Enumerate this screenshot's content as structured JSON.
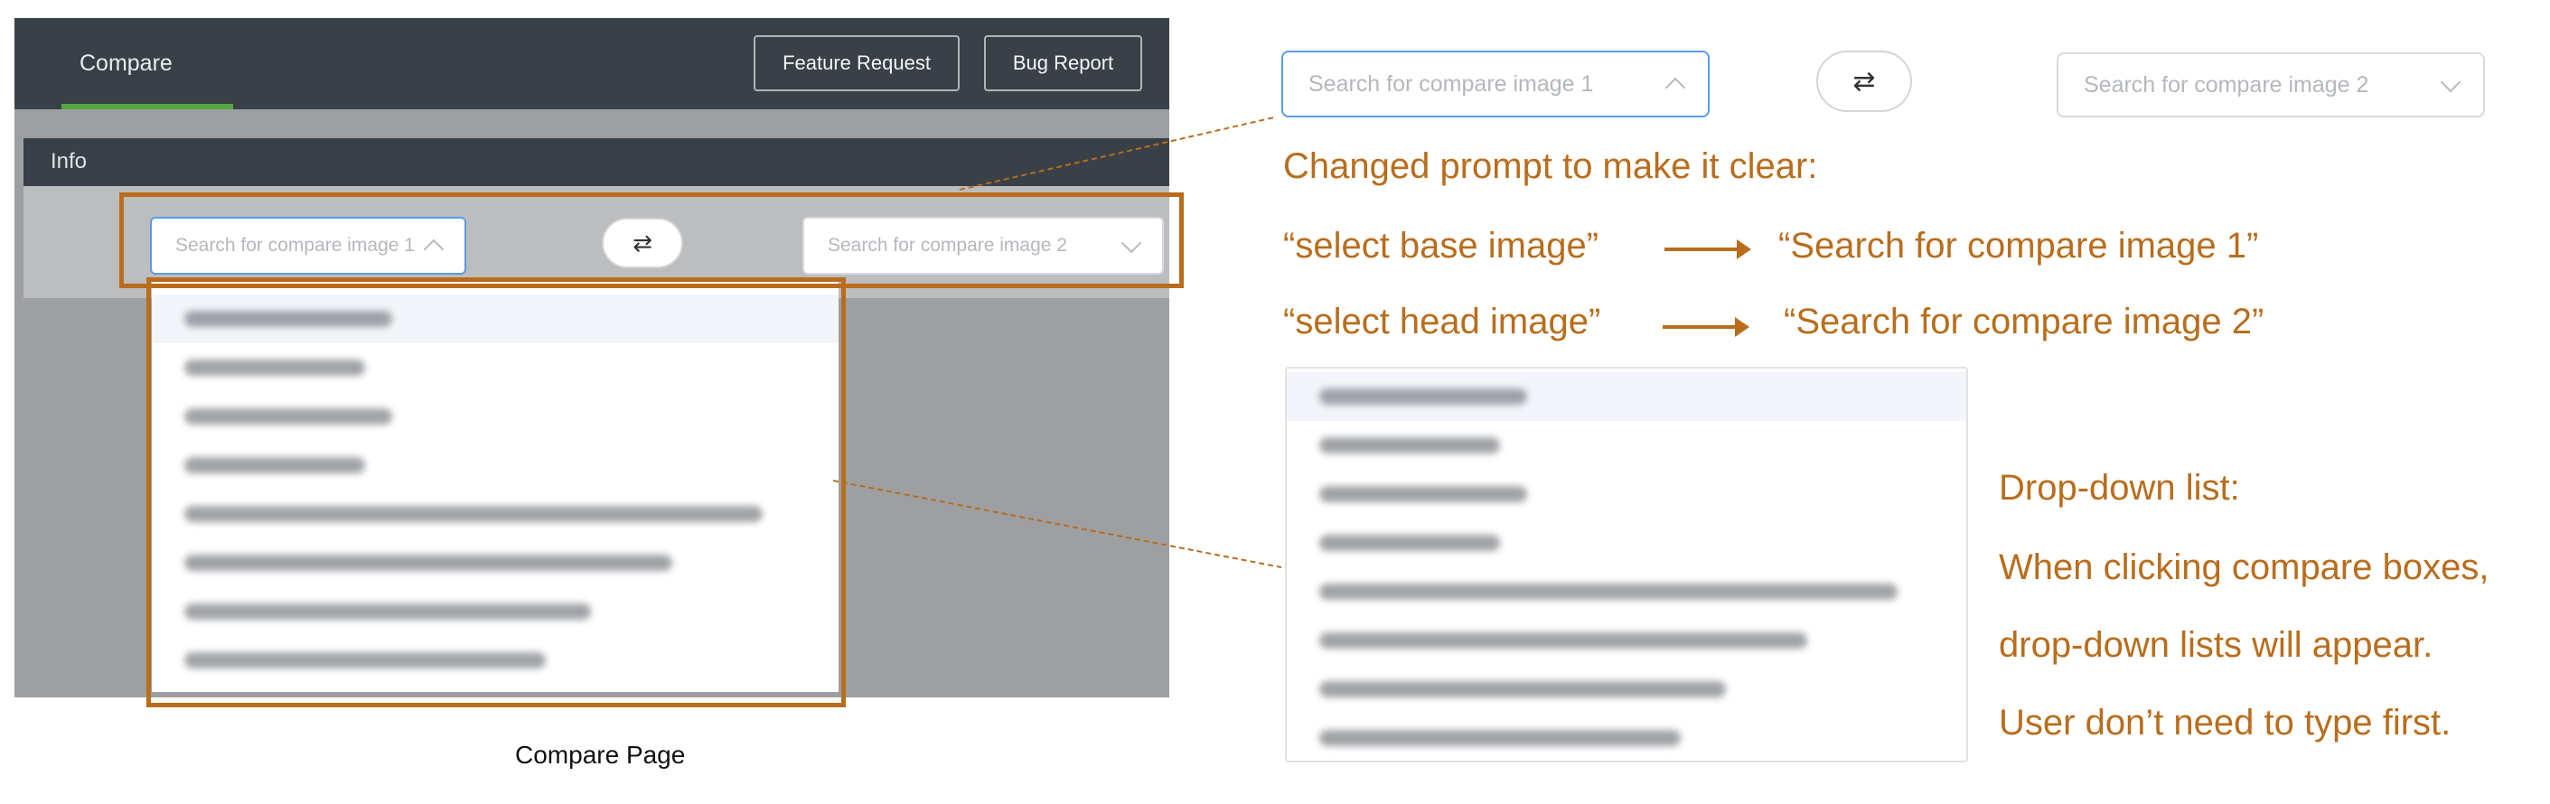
{
  "left_screenshot": {
    "nav": {
      "tab_compare": "Compare",
      "feature_request": "Feature Request",
      "bug_report": "Bug Report"
    },
    "info_label": "Info",
    "select1_placeholder": "Search for compare image 1",
    "select2_placeholder": "Search for compare image 2",
    "swap_icon": "⇄",
    "dropdown_item_count": 8
  },
  "caption": "Compare Page",
  "right_annotation": {
    "select1_placeholder": "Search for compare image 1",
    "select2_placeholder": "Search for compare image 2",
    "swap_icon": "⇄",
    "heading": "Changed prompt to make it clear:",
    "old_label_1": "“select base image”",
    "new_label_1": "“Search for compare image 1”",
    "old_label_2": "“select head image”",
    "new_label_2": "“Search for compare image 2”",
    "note_lines": [
      "Drop-down list:",
      "When clicking compare boxes,",
      "drop-down lists will appear.",
      "User don’t need to type first."
    ]
  },
  "colors": {
    "annotation_orange": "#b96d1c",
    "nav_dark": "#3a4047",
    "tab_underline_green": "#55a744",
    "focus_blue": "#5a9bea"
  }
}
